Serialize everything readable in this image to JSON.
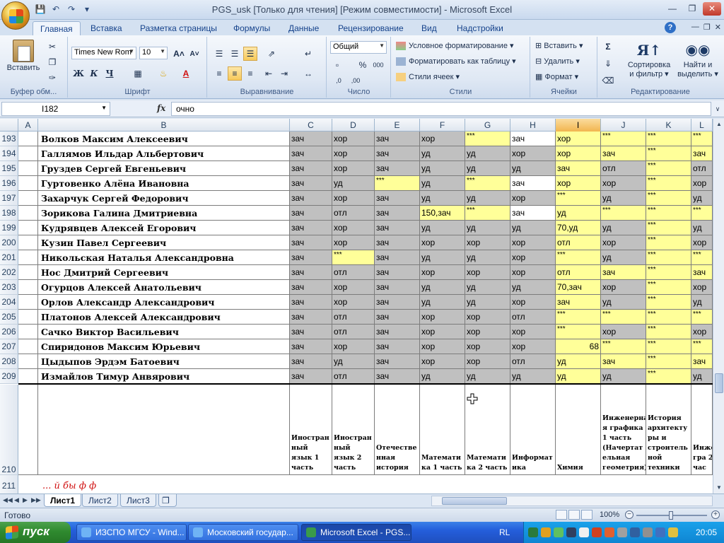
{
  "window": {
    "title": "PGS_usk  [Только для чтения]  [Режим совместимости] - Microsoft Excel"
  },
  "ribbon_tabs": [
    "Главная",
    "Вставка",
    "Разметка страницы",
    "Формулы",
    "Данные",
    "Рецензирование",
    "Вид",
    "Надстройки"
  ],
  "ribbon": {
    "clipboard": {
      "paste": "Вставить",
      "label": "Буфер обм..."
    },
    "font": {
      "name": "Times New Rom",
      "size": "10",
      "label": "Шрифт"
    },
    "alignment": {
      "label": "Выравнивание"
    },
    "number": {
      "format": "Общий",
      "label": "Число"
    },
    "styles": {
      "conditional": "Условное форматирование",
      "as_table": "Форматировать как таблицу",
      "cell_styles": "Стили ячеек",
      "label": "Стили"
    },
    "cells": {
      "insert": "Вставить",
      "delete": "Удалить",
      "format": "Формат",
      "label": "Ячейки"
    },
    "editing": {
      "sort_line1": "Сортировка",
      "sort_line2": "и фильтр",
      "find_line1": "Найти и",
      "find_line2": "выделить",
      "label": "Редактирование"
    }
  },
  "formula_bar": {
    "cell_ref": "I182",
    "fx": "fx",
    "value": "очно"
  },
  "columns": [
    "A",
    "B",
    "C",
    "D",
    "E",
    "F",
    "G",
    "H",
    "I",
    "J",
    "K",
    "L"
  ],
  "rows": [
    {
      "num": "193",
      "name": "Волков Максим Алексеевич",
      "cells": [
        "зач",
        "хор",
        "зач",
        "хор",
        "***",
        "зач",
        "хор",
        "***",
        "***",
        "***"
      ]
    },
    {
      "num": "194",
      "name": "Галлямов Ильдар Альбертович",
      "cells": [
        "зач",
        "хор",
        "зач",
        "уд",
        "уд",
        "хор",
        "хор",
        "зач",
        "***",
        "зач"
      ]
    },
    {
      "num": "195",
      "name": "Груздев Сергей Евгеньевич",
      "cells": [
        "зач",
        "хор",
        "зач",
        "уд",
        "уд",
        "уд",
        "зач",
        "отл",
        "***",
        "отл"
      ]
    },
    {
      "num": "196",
      "name": "Гуртовенко Алёна Ивановна",
      "cells": [
        "зач",
        "уд",
        "***",
        "уд",
        "***",
        "зач",
        "хор",
        "хор",
        "***",
        "хор"
      ]
    },
    {
      "num": "197",
      "name": "Захарчук Сергей Федорович",
      "cells": [
        "зач",
        "хор",
        "зач",
        "уд",
        "уд",
        "хор",
        "***",
        "уд",
        "***",
        "уд"
      ]
    },
    {
      "num": "198",
      "name": "Зорикова Галина Дмитриевна",
      "cells": [
        "зач",
        "отл",
        "зач",
        "150,зач",
        "***",
        "зач",
        "уд",
        "***",
        "***",
        "***"
      ]
    },
    {
      "num": "199",
      "name": "Кудрявцев Алексей Егорович",
      "cells": [
        "зач",
        "хор",
        "зач",
        "уд",
        "уд",
        "уд",
        "70,уд",
        "уд",
        "***",
        "уд"
      ]
    },
    {
      "num": "200",
      "name": "Кузин Павел Сергеевич",
      "cells": [
        "зач",
        "хор",
        "зач",
        "хор",
        "хор",
        "хор",
        "отл",
        "хор",
        "***",
        "хор"
      ]
    },
    {
      "num": "201",
      "name": "Никольская Наталья Александровна",
      "cells": [
        "зач",
        "***",
        "зач",
        "уд",
        "уд",
        "хор",
        "***",
        "уд",
        "***",
        "***"
      ]
    },
    {
      "num": "202",
      "name": "Нос Дмитрий Сергеевич",
      "cells": [
        "зач",
        "отл",
        "зач",
        "хор",
        "хор",
        "хор",
        "отл",
        "зач",
        "***",
        "зач"
      ]
    },
    {
      "num": "203",
      "name": "Огурцов Алексей Анатольевич",
      "cells": [
        "зач",
        "хор",
        "зач",
        "уд",
        "уд",
        "уд",
        "70,зач",
        "хор",
        "***",
        "хор"
      ]
    },
    {
      "num": "204",
      "name": "Орлов Александр Александрович",
      "cells": [
        "зач",
        "хор",
        "зач",
        "уд",
        "уд",
        "хор",
        "зач",
        "уд",
        "***",
        "уд"
      ]
    },
    {
      "num": "205",
      "name": "Платонов Алексей Александрович",
      "cells": [
        "зач",
        "отл",
        "зач",
        "хор",
        "хор",
        "отл",
        "***",
        "***",
        "***",
        "***"
      ]
    },
    {
      "num": "206",
      "name": "Сачко Виктор Васильевич",
      "cells": [
        "зач",
        "отл",
        "зач",
        "хор",
        "хор",
        "хор",
        "***",
        "хор",
        "***",
        "хор"
      ]
    },
    {
      "num": "207",
      "name": "Спиридонов Максим Юрьевич",
      "cells": [
        "зач",
        "хор",
        "зач",
        "хор",
        "хор",
        "хор",
        "68",
        "***",
        "***",
        "***"
      ]
    },
    {
      "num": "208",
      "name": "Цыдыпов Эрдэм Батоевич",
      "cells": [
        "зач",
        "уд",
        "зач",
        "хор",
        "хор",
        "отл",
        "уд",
        "зач",
        "***",
        "зач"
      ]
    },
    {
      "num": "209",
      "name": "Измайлов Тимур Анвярович",
      "cells": [
        "зач",
        "отл",
        "зач",
        "уд",
        "уд",
        "уд",
        "уд",
        "уд",
        "***",
        "уд"
      ]
    }
  ],
  "header_row": {
    "num": "210",
    "labels": [
      "Иностран ный язык 1 часть",
      "Иностран ный язык 2 часть",
      "Отечестве нная история",
      "Математи ка 1 часть",
      "Математи ка 2 часть",
      "Информат ика",
      "Химия",
      "Инженерна я графика 1 часть (Начертат ельная геометрия)",
      "История архитекту ры и строитель ной техники",
      "Инже гра 2 час"
    ]
  },
  "next_row_num": "211",
  "red_text": "... й бы   ф   ф",
  "sheets": [
    "Лист1",
    "Лист2",
    "Лист3"
  ],
  "status": {
    "ready": "Готово",
    "zoom": "100%"
  },
  "taskbar": {
    "start": "пуск",
    "tasks": [
      "ИЗСПО МГСУ - Wind...",
      "Московский государ...",
      "Microsoft Excel - PGS..."
    ],
    "lang": "RL",
    "clock": "20:05"
  },
  "colors": {
    "gray": "#c0c0c0",
    "yellow": "#ffff99",
    "white": "#ffffff",
    "selected_col": "#f2b54f"
  }
}
